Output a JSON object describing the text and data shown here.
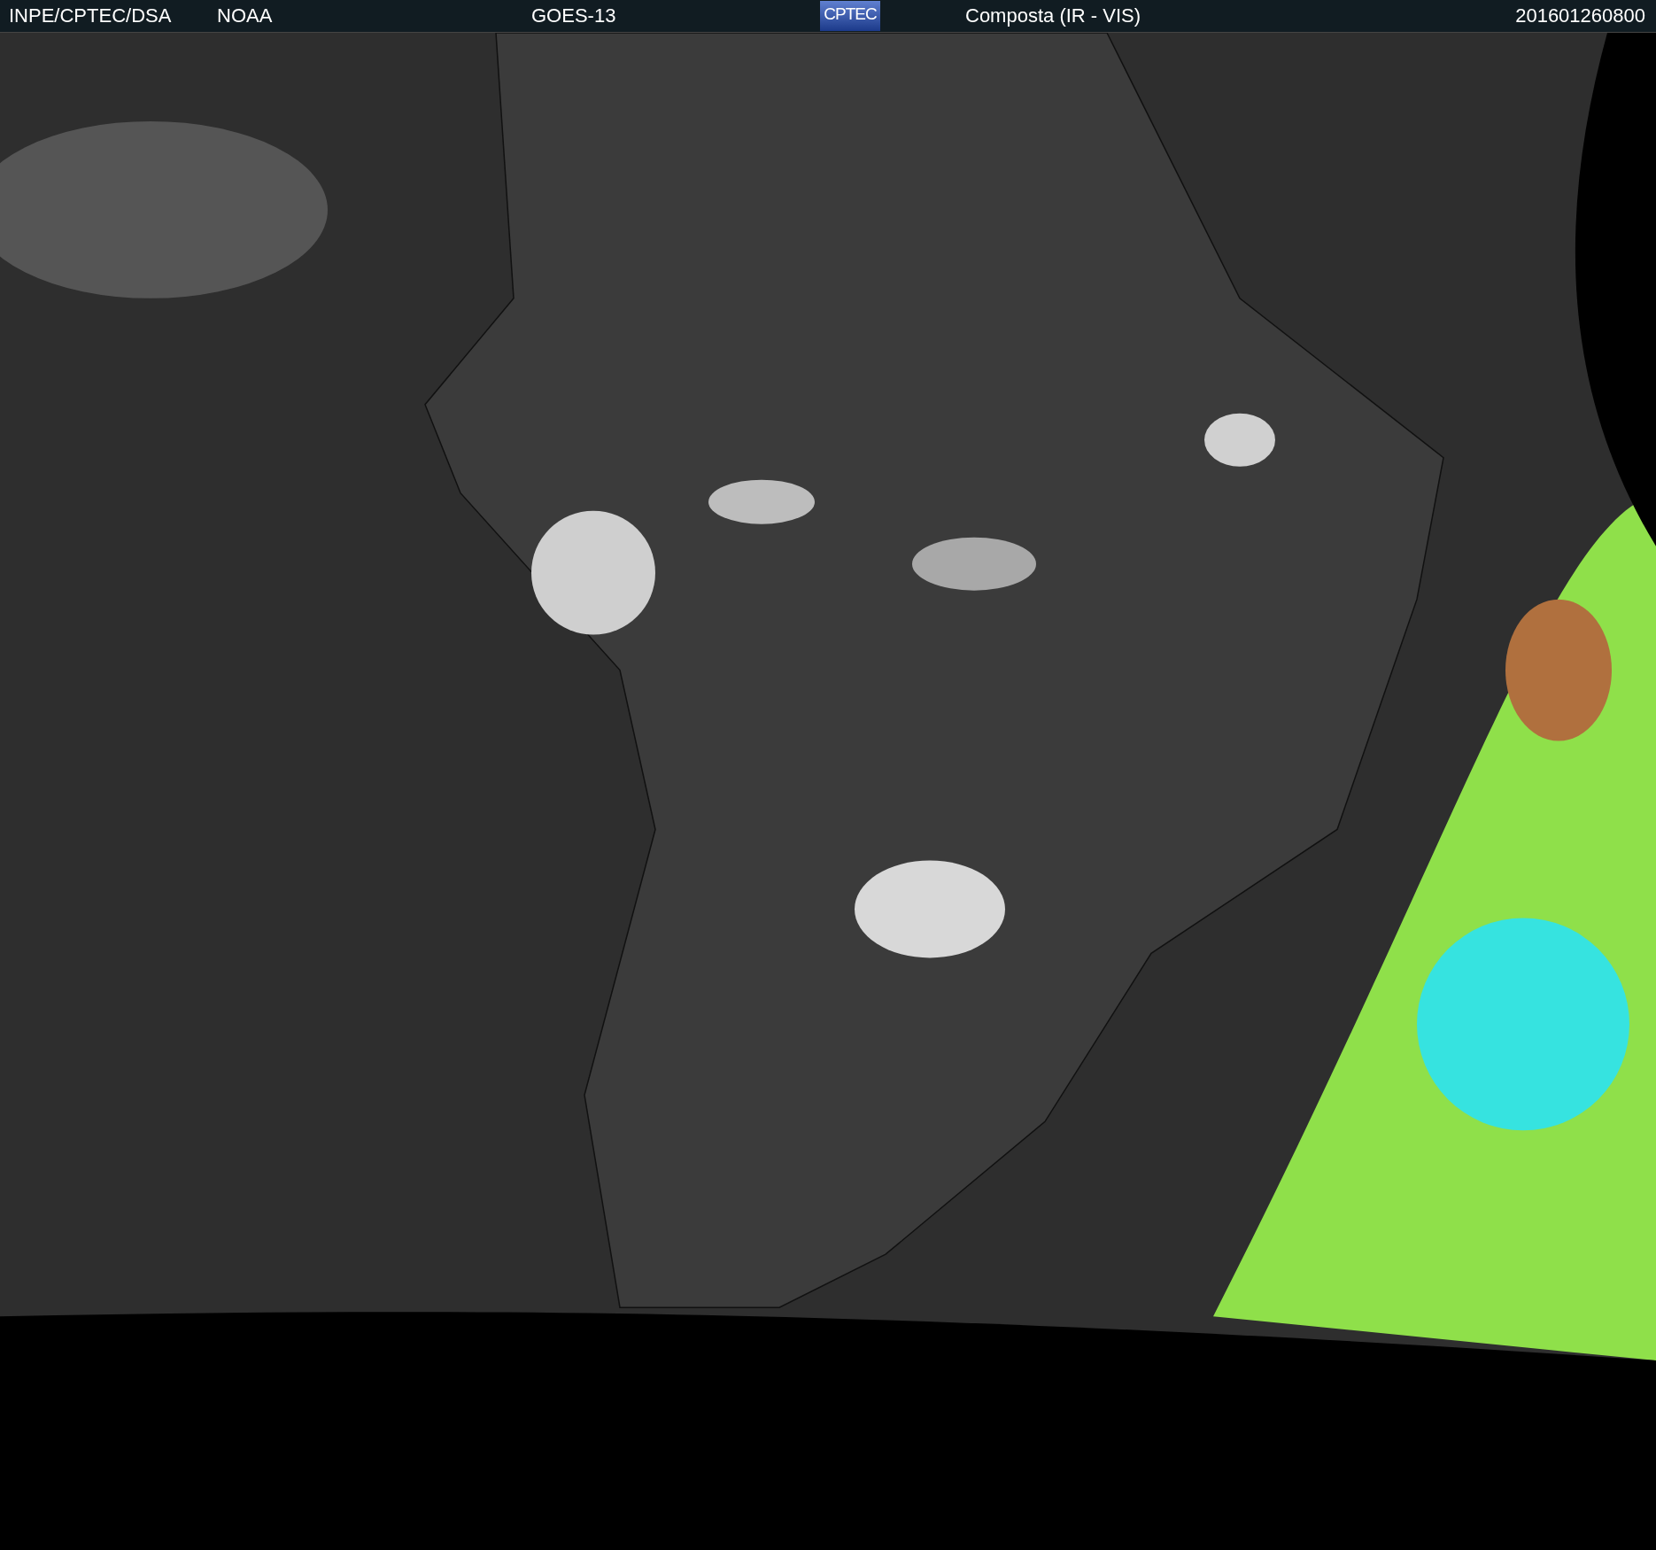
{
  "header": {
    "items": [
      {
        "kind": "text",
        "text": "INPE/CPTEC/DSA"
      },
      {
        "kind": "text",
        "text": "NOAA"
      },
      {
        "kind": "text",
        "text": "GOES-13"
      },
      {
        "kind": "logo",
        "text": "CPTEC"
      },
      {
        "kind": "text",
        "text": "Composta (IR - VIS)"
      },
      {
        "kind": "text",
        "text": "201601260800"
      }
    ]
  }
}
